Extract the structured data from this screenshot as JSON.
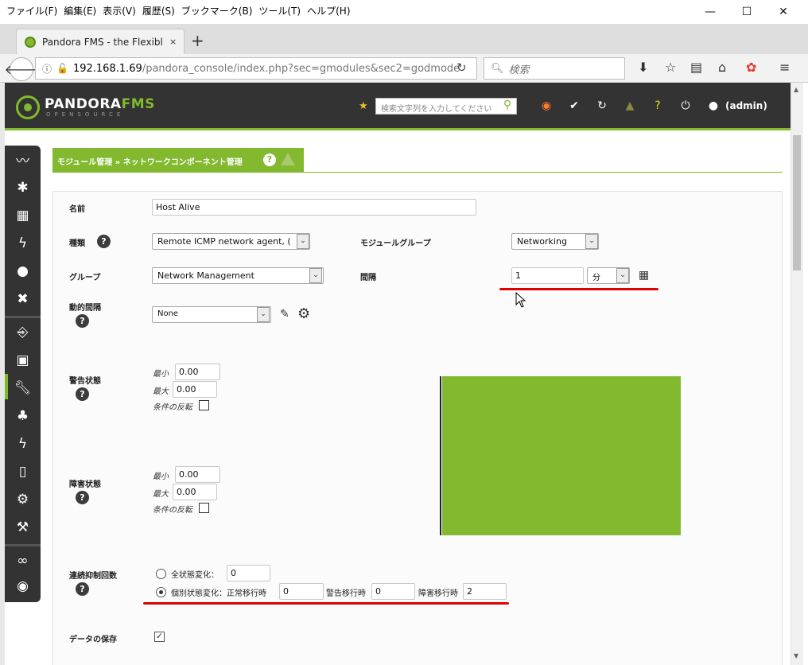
{
  "browser": {
    "menu": [
      "ファイル(F)",
      "編集(E)",
      "表示(V)",
      "履歴(S)",
      "ブックマーク(B)",
      "ツール(T)",
      "ヘルプ(H)"
    ],
    "tab_title": "Pandora FMS - the Flexible M",
    "tab_close": "×",
    "new_tab": "+",
    "url_host": "192.168.1.69",
    "url_path": "/pandora_console/index.php?sec=gmodules&sec2=godmode",
    "search_placeholder": "検索"
  },
  "header": {
    "logo_main": "PANDORA",
    "logo_fms": "FMS",
    "logo_sub": "OPENSOURCE",
    "search_placeholder": "検索文字列を入力してください",
    "user": "(admin)"
  },
  "breadcrumb": {
    "text": "モジュール管理 » ネットワークコンポーネント管理",
    "help": "?"
  },
  "form": {
    "name_label": "名前",
    "name_value": "Host Alive",
    "type_label": "種類",
    "type_value": "Remote ICMP network agent, (",
    "module_group_label": "モジュールグループ",
    "module_group_value": "Networking",
    "group_label": "グループ",
    "group_value": "Network Management",
    "interval_label": "間隔",
    "interval_value": "1",
    "interval_unit": "分",
    "dynamic_label": "動的間隔",
    "dynamic_value": "None",
    "warning_label": "警告状態",
    "critical_label": "障害状態",
    "min_label": "最小",
    "max_label": "最大",
    "invert_label": "条件の反転",
    "warning_min": "0.00",
    "warning_max": "0.00",
    "critical_min": "0.00",
    "critical_max": "0.00",
    "ff_label": "連続抑制回数",
    "ff_all_label": "全状態変化：",
    "ff_all_value": "0",
    "ff_each_label": "個別状態変化：正常移行時",
    "ff_normal_value": "0",
    "ff_warning_label": "警告移行時",
    "ff_warning_value": "0",
    "ff_critical_label": "障害移行時",
    "ff_critical_value": "2",
    "data_save_label": "データの保存",
    "help": "?"
  },
  "colors": {
    "brand_green": "#82b92e",
    "header_dark": "#333333",
    "annotation_red": "#e00000"
  }
}
